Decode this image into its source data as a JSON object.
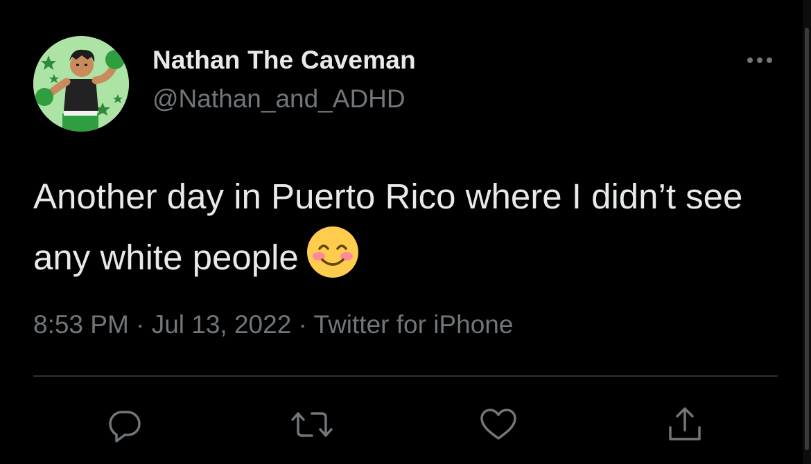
{
  "author": {
    "display_name": "Nathan The Caveman",
    "handle": "@Nathan_and_ADHD",
    "avatar_icon": "boxer-character-avatar"
  },
  "tweet": {
    "text": "Another day in Puerto Rico where I didn’t see any white people",
    "emoji": "smiling-face-with-smiling-eyes-emoji"
  },
  "meta": {
    "time": "8:53 PM",
    "separator": " · ",
    "date": "Jul 13, 2022",
    "source": "Twitter for iPhone"
  },
  "actions": [
    {
      "name": "reply",
      "icon": "reply-icon"
    },
    {
      "name": "retweet",
      "icon": "retweet-icon"
    },
    {
      "name": "like",
      "icon": "heart-icon"
    },
    {
      "name": "share",
      "icon": "share-icon"
    }
  ],
  "colors": {
    "background": "#000000",
    "primary_text": "#e7e9ea",
    "secondary_text": "#71767b",
    "divider": "#2f3336",
    "avatar_background": "#aee3a6"
  }
}
